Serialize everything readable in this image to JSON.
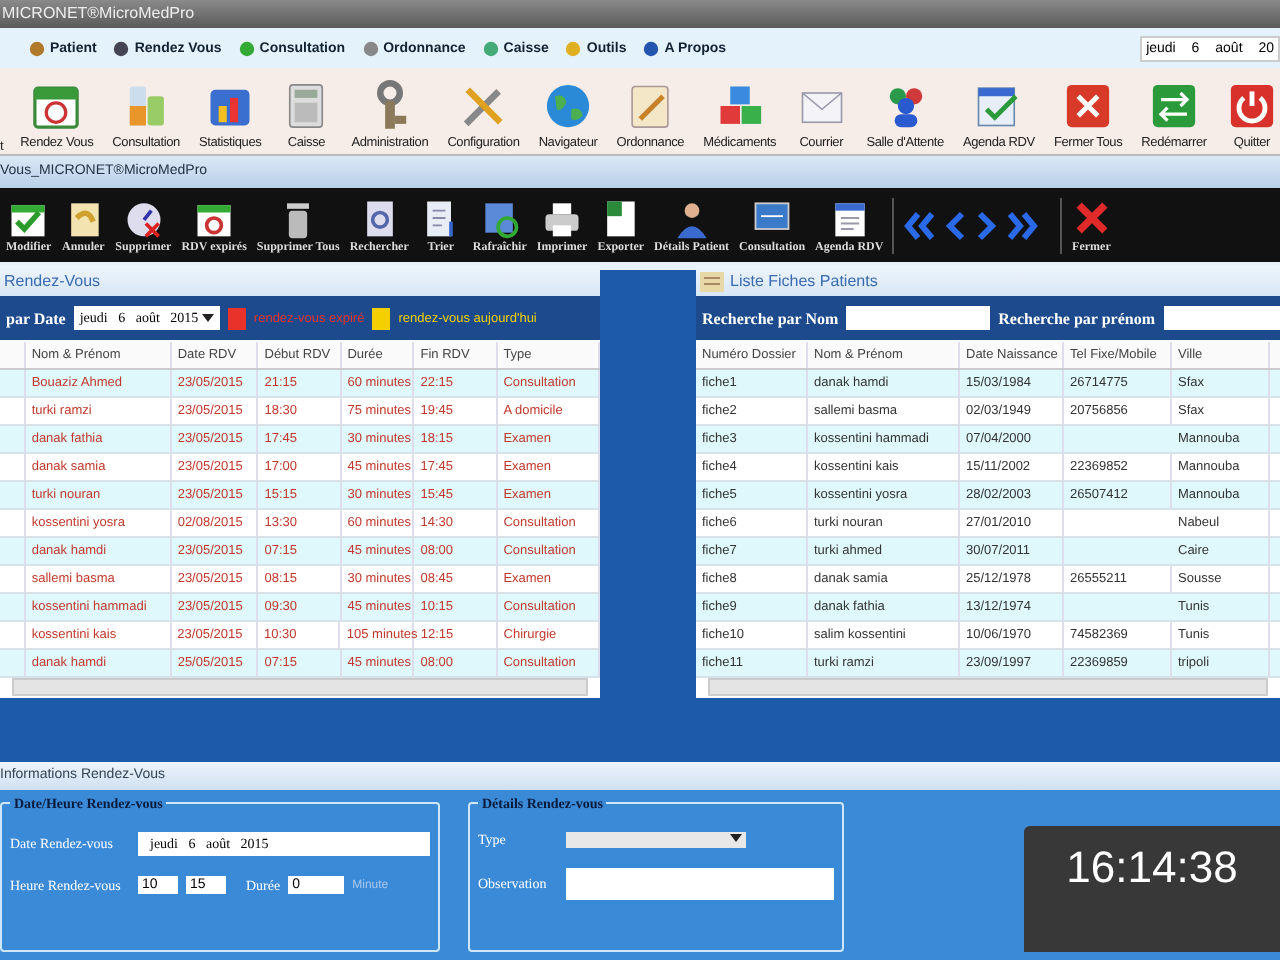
{
  "window": {
    "title": "MICRONET®MicroMedPro"
  },
  "menu": [
    {
      "label": "Patient"
    },
    {
      "label": "Rendez Vous"
    },
    {
      "label": "Consultation"
    },
    {
      "label": "Ordonnance"
    },
    {
      "label": "Caisse"
    },
    {
      "label": "Outils"
    },
    {
      "label": "A Propos"
    }
  ],
  "menu_date": "jeudi 6 août 20",
  "ribbon": [
    {
      "label": "t"
    },
    {
      "label": "Rendez Vous"
    },
    {
      "label": "Consultation"
    },
    {
      "label": "Statistiques"
    },
    {
      "label": "Caisse"
    },
    {
      "label": "Administration"
    },
    {
      "label": "Configuration"
    },
    {
      "label": "Navigateur"
    },
    {
      "label": "Ordonnance"
    },
    {
      "label": "Médicaments"
    },
    {
      "label": "Courrier"
    },
    {
      "label": "Salle d'Attente"
    },
    {
      "label": "Agenda RDV"
    },
    {
      "label": "Fermer Tous"
    },
    {
      "label": "Redémarrer"
    },
    {
      "label": "Quitter"
    }
  ],
  "child_window": {
    "title": "Vous_MICRONET®MicroMedPro"
  },
  "toolbar": [
    {
      "label": "Modifier"
    },
    {
      "label": "Annuler"
    },
    {
      "label": "Supprimer"
    },
    {
      "label": "RDV expirés"
    },
    {
      "label": "Supprimer Tous"
    },
    {
      "label": "Rechercher"
    },
    {
      "label": "Trier"
    },
    {
      "label": "Rafraîchir"
    },
    {
      "label": "Imprimer"
    },
    {
      "label": "Exporter"
    },
    {
      "label": "Détails Patient"
    },
    {
      "label": "Consultation"
    },
    {
      "label": "Agenda RDV"
    },
    {
      "label": "Fermer"
    }
  ],
  "appointments": {
    "title": "Rendez-Vous",
    "filter_label": "par Date",
    "filter_date": "jeudi   6   août   2015",
    "legend": [
      {
        "label": "rendez-vous expiré",
        "color": "#e8322a"
      },
      {
        "label": "rendez-vous aujourd'hui",
        "color": "#f5d000"
      }
    ],
    "columns": [
      "Nom & Prénom",
      "Date RDV",
      "Début RDV",
      "Durée",
      "Fin RDV",
      "Type"
    ],
    "rows": [
      [
        "Bouaziz Ahmed",
        "23/05/2015",
        "21:15",
        "60 minutes",
        "22:15",
        "Consultation"
      ],
      [
        "turki ramzi",
        "23/05/2015",
        "18:30",
        "75 minutes",
        "19:45",
        "A domicile"
      ],
      [
        "danak fathia",
        "23/05/2015",
        "17:45",
        "30 minutes",
        "18:15",
        "Examen"
      ],
      [
        "danak samia",
        "23/05/2015",
        "17:00",
        "45 minutes",
        "17:45",
        "Examen"
      ],
      [
        "turki nouran",
        "23/05/2015",
        "15:15",
        "30 minutes",
        "15:45",
        "Examen"
      ],
      [
        "kossentini yosra",
        "02/08/2015",
        "13:30",
        "60 minutes",
        "14:30",
        "Consultation"
      ],
      [
        "danak hamdi",
        "23/05/2015",
        "07:15",
        "45 minutes",
        "08:00",
        "Consultation"
      ],
      [
        "sallemi basma",
        "23/05/2015",
        "08:15",
        "30 minutes",
        "08:45",
        "Examen"
      ],
      [
        "kossentini hammadi",
        "23/05/2015",
        "09:30",
        "45 minutes",
        "10:15",
        "Consultation"
      ],
      [
        "kossentini kais",
        "23/05/2015",
        "10:30",
        "105 minutes",
        "12:15",
        "Chirurgie"
      ],
      [
        "danak hamdi",
        "25/05/2015",
        "07:15",
        "45 minutes",
        "08:00",
        "Consultation"
      ]
    ]
  },
  "patients": {
    "title": "Liste Fiches Patients",
    "search_name_label": "Recherche par Nom",
    "search_first_label": "Recherche par prénom",
    "columns": [
      "Numéro Dossier",
      "Nom & Prénom",
      "Date Naissance",
      "Tel Fixe/Mobile",
      "Ville"
    ],
    "rows": [
      {
        "id": "fiche1",
        "name": "danak hamdi",
        "birth": "15/03/1984",
        "tel": "26714775",
        "city": "Sfax"
      },
      {
        "id": "fiche2",
        "name": "sallemi basma",
        "birth": "02/03/1949",
        "tel": "20756856",
        "city": "Sfax"
      },
      {
        "id": "fiche3",
        "name": "kossentini hammadi",
        "birth": "07/04/2000",
        "city": "Mannouba"
      },
      {
        "id": "fiche4",
        "name": "kossentini kais",
        "birth": "15/11/2002",
        "tel": "22369852",
        "city": "Mannouba"
      },
      {
        "id": "fiche5",
        "name": "kossentini yosra",
        "birth": "28/02/2003",
        "tel": "26507412",
        "city": "Mannouba"
      },
      {
        "id": "fiche6",
        "name": "turki nouran",
        "birth": "27/01/2010",
        "city": "Nabeul"
      },
      {
        "id": "fiche7",
        "name": "turki ahmed",
        "birth": "30/07/2011",
        "city": "Caire"
      },
      {
        "id": "fiche8",
        "name": "danak samia",
        "birth": "25/12/1978",
        "tel": "26555211",
        "city": "Sousse"
      },
      {
        "id": "fiche9",
        "name": "danak fathia",
        "birth": "13/12/1974",
        "city": "Tunis"
      },
      {
        "id": "fiche10",
        "name": "salim kossentini",
        "birth": "10/06/1970",
        "tel": "74582369",
        "city": "Tunis"
      },
      {
        "id": "fiche11",
        "name": "turki ramzi",
        "birth": "23/09/1997",
        "tel": "22369859",
        "city": "tripoli"
      }
    ]
  },
  "details": {
    "title": "Informations Rendez-Vous",
    "datetime_group": {
      "legend": "Date/Heure Rendez-vous",
      "date_label": "Date Rendez-vous",
      "date": "jeudi   6   août   2015",
      "time_label": "Heure Rendez-vous",
      "hour": "10",
      "minute": "15",
      "duration_label": "Durée",
      "duration": "0",
      "unit": "Minute"
    },
    "info_group": {
      "legend": "Détails Rendez-vous",
      "type_label": "Type",
      "observation_label": "Observation"
    }
  },
  "clock": {
    "time": "16:14:38"
  }
}
